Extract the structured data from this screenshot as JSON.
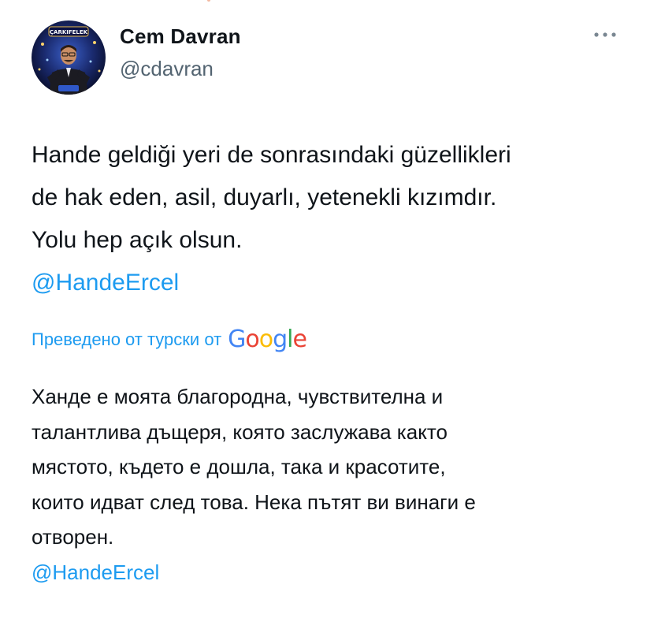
{
  "author": {
    "name": "Cem Davran",
    "handle": "@cdavran",
    "avatar_banner_text": "ÇARKIFELEK"
  },
  "tweet": {
    "lines": [
      "Hande geldiği yeri de sonrasındaki güzellikleri",
      "de hak eden, asil, duyarlı, yetenekli kızımdır.",
      "Yolu hep açık olsun."
    ],
    "mention": "@HandeErcel"
  },
  "translation": {
    "label": "Преведено от турски от",
    "provider": "Google",
    "lines": [
      "Ханде е моята благородна, чувствителна и",
      "талантлива дъщеря, която заслужава както",
      "мястото, където е дошла, така и красотите,",
      "които идват след това. Нека пътят ви винаги е",
      "отворен."
    ],
    "mention": "@HandeErcel"
  },
  "colors": {
    "link": "#1d9bf0",
    "text": "#0f1419",
    "secondary": "#536471",
    "google_blue": "#4285F4",
    "google_red": "#EA4335",
    "google_yellow": "#FBBC05",
    "google_green": "#34A853"
  },
  "icons": {
    "more": "more-horizontal-icon"
  }
}
